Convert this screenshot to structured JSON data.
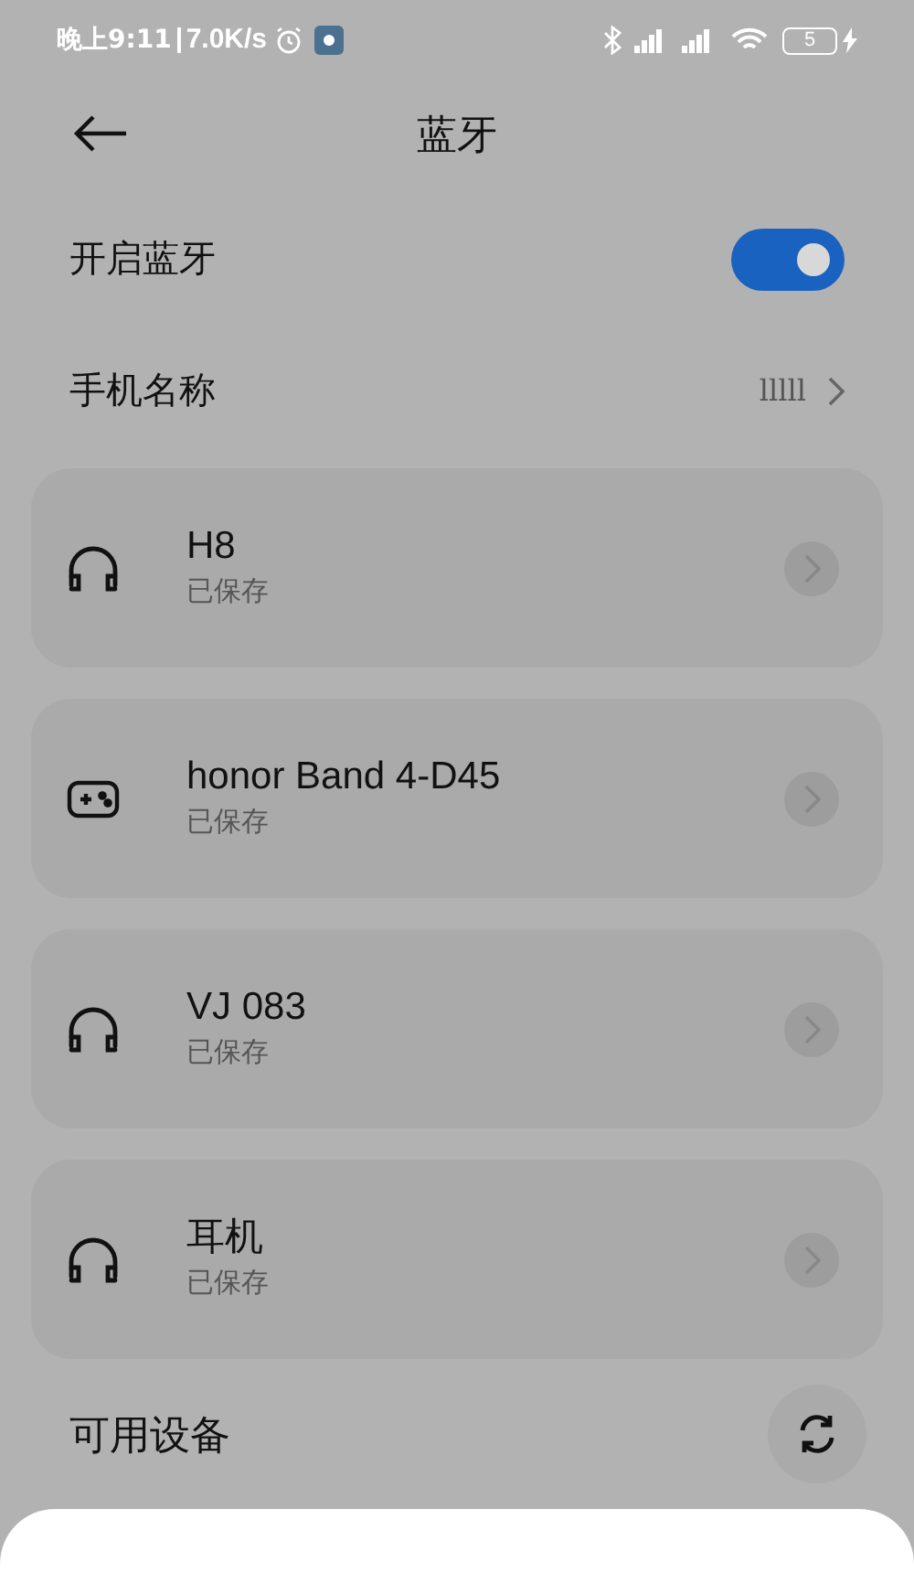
{
  "status_bar": {
    "time": "晚上9:11",
    "speed": "7.0K/s",
    "battery": "5"
  },
  "header": {
    "title": "蓝牙"
  },
  "bluetooth_toggle": {
    "label": "开启蓝牙",
    "on": true
  },
  "phone_name": {
    "label": "手机名称",
    "value": "lllll"
  },
  "devices": [
    {
      "name": "H8",
      "status": "已保存",
      "kind": "headphones"
    },
    {
      "name": "honor Band 4-D45",
      "status": "已保存",
      "kind": "gamepad"
    },
    {
      "name": "VJ 083",
      "status": "已保存",
      "kind": "headphones"
    },
    {
      "name": "耳机",
      "status": "已保存",
      "kind": "headphones"
    }
  ],
  "available": {
    "label": "可用设备"
  }
}
